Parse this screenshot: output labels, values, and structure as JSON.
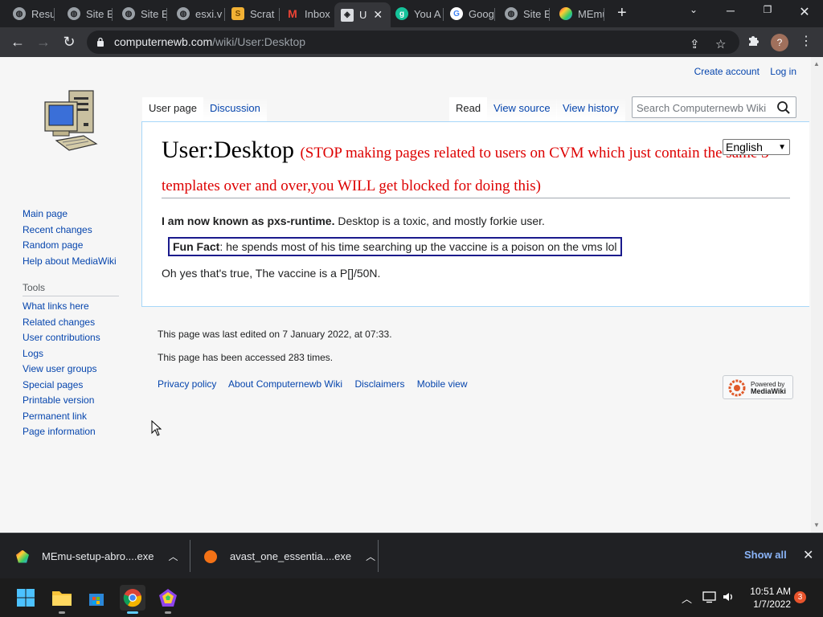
{
  "browser": {
    "tabs": [
      {
        "label": "Resu",
        "icon": "globe-icon"
      },
      {
        "label": "Site E",
        "icon": "globe-icon"
      },
      {
        "label": "Site E",
        "icon": "globe-icon"
      },
      {
        "label": "esxi.v",
        "icon": "globe-icon"
      },
      {
        "label": "Scrat",
        "icon": "scratch-icon"
      },
      {
        "label": "Inbox",
        "icon": "gmail-icon"
      },
      {
        "label": "U",
        "icon": "wiki-icon"
      },
      {
        "label": "You A",
        "icon": "grammarly-icon"
      },
      {
        "label": "Goog",
        "icon": "google-icon"
      },
      {
        "label": "Site E",
        "icon": "globe-icon"
      },
      {
        "label": "MEmu",
        "icon": "memu-icon"
      }
    ],
    "new_tab_label": "+",
    "url_host": "computernewb.com",
    "url_path": "/wiki/User:Desktop"
  },
  "personal": {
    "create_account": "Create account",
    "log_in": "Log in"
  },
  "page_tabs": {
    "user_page": "User page",
    "discussion": "Discussion",
    "read": "Read",
    "view_source": "View source",
    "view_history": "View history"
  },
  "search": {
    "placeholder": "Search Computernewb Wiki"
  },
  "sidebar": {
    "main": [
      "Main page",
      "Recent changes",
      "Random page",
      "Help about MediaWiki"
    ],
    "tools_heading": "Tools",
    "tools": [
      "What links here",
      "Related changes",
      "User contributions",
      "Logs",
      "View user groups",
      "Special pages",
      "Printable version",
      "Permanent link",
      "Page information"
    ]
  },
  "article": {
    "title": "User:Desktop",
    "warning": "(STOP making pages related to users on CVM which just contain the same 3 templates over and over,you WILL get blocked for doing this)",
    "language": "English",
    "intro_bold": "I am now known as pxs-runtime.",
    "intro_rest": " Desktop is a toxic, and mostly forkie user.",
    "fun_fact_label": "Fun Fact",
    "fun_fact_text": ": he spends most of his time searching up the vaccine is a poison on the vms lol",
    "outro": "Oh yes that's true, The vaccine is a P[]/50N."
  },
  "footer": {
    "last_edited": "This page was last edited on 7 January 2022, at 07:33.",
    "accessed": "This page has been accessed 283 times.",
    "links": [
      "Privacy policy",
      "About Computernewb Wiki",
      "Disclaimers",
      "Mobile view"
    ],
    "powered_by_line1": "Powered by",
    "powered_by_line2": "MediaWiki"
  },
  "downloads": {
    "items": [
      {
        "name": "MEmu-setup-abro....exe",
        "icon": "memu-icon"
      },
      {
        "name": "avast_one_essentia....exe",
        "icon": "avast-icon"
      }
    ],
    "show_all": "Show all"
  },
  "taskbar": {
    "time": "10:51 AM",
    "date": "1/7/2022",
    "notification_count": "3"
  },
  "colors": {
    "link": "#0645ad",
    "warning": "#dd0000",
    "funfact_border": "#1a1a8c",
    "chrome_dark": "#202124"
  }
}
